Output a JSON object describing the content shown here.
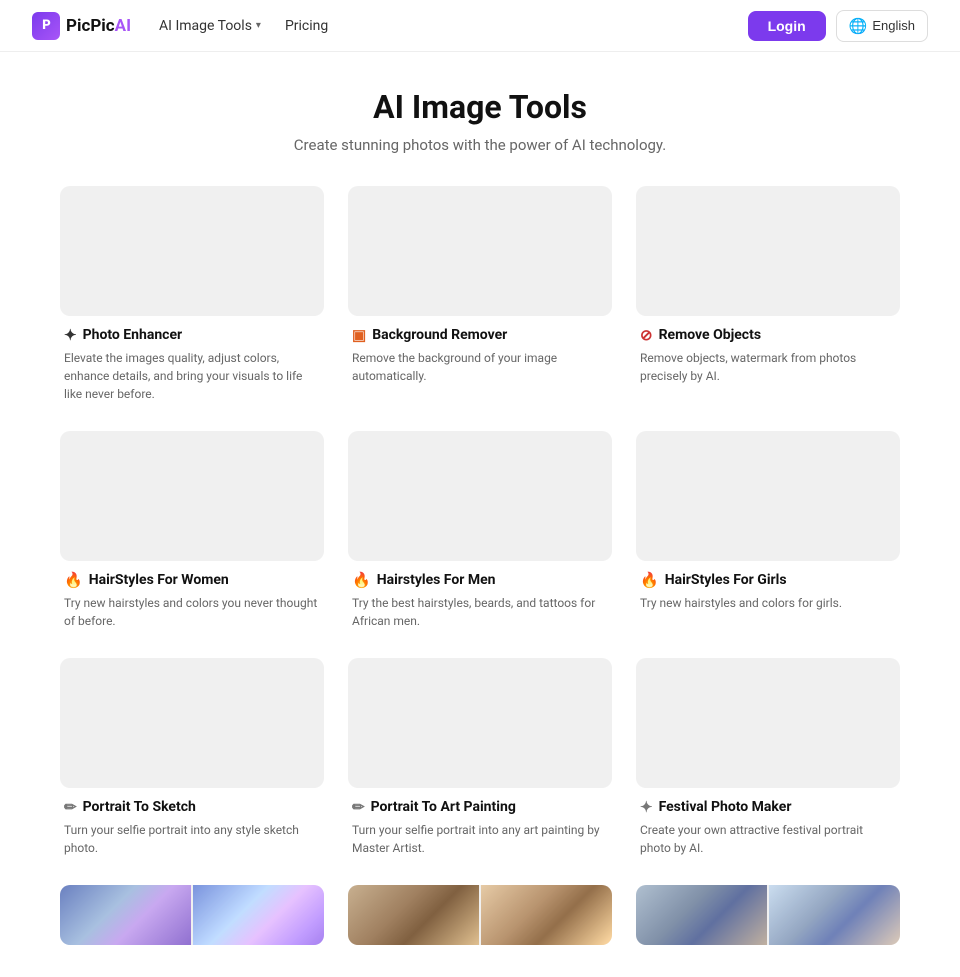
{
  "nav": {
    "logo_letter": "P",
    "logo_name_1": "PicPic",
    "logo_name_2": "AI",
    "menu": [
      {
        "label": "AI Image Tools",
        "has_dropdown": true
      },
      {
        "label": "Pricing",
        "has_dropdown": false
      }
    ],
    "login_label": "Login",
    "lang_label": "English"
  },
  "hero": {
    "title": "AI Image Tools",
    "subtitle": "Create stunning photos with the power of AI technology."
  },
  "tools": [
    {
      "id": "photo-enhancer",
      "icon": "✦",
      "icon_class": "icon-enhance",
      "title": "Photo Enhancer",
      "desc": "Elevate the images quality, adjust colors, enhance details, and bring your visuals to life like never before.",
      "img_class": "img-fox",
      "split": true,
      "img_class2": "img-fox"
    },
    {
      "id": "bg-remover",
      "icon": "▣",
      "icon_class": "icon-bg",
      "title": "Background Remover",
      "desc": "Remove the background of your image automatically.",
      "img_class": "img-girl",
      "split": true,
      "img_class2": "img-girl"
    },
    {
      "id": "remove-objects",
      "icon": "⊘",
      "icon_class": "icon-remove",
      "title": "Remove Objects",
      "desc": "Remove objects, watermark from photos precisely by AI.",
      "img_class": "img-dog",
      "split": true,
      "img_class2": "img-dog"
    },
    {
      "id": "hairstyles-women",
      "icon": "🔥",
      "icon_class": "icon-hair-w",
      "title": "HairStyles For Women",
      "desc": "Try new hairstyles and colors you never thought of before.",
      "img_class": "img-women",
      "split": true,
      "img_class2": "img-women"
    },
    {
      "id": "hairstyles-men",
      "icon": "🔥",
      "icon_class": "icon-hair-m",
      "title": "Hairstyles For Men",
      "desc": "Try the best hairstyles, beards, and tattoos for African men.",
      "img_class": "img-men",
      "split": true,
      "img_class2": "img-men"
    },
    {
      "id": "hairstyles-girls",
      "icon": "🔥",
      "icon_class": "icon-hair-g",
      "title": "HairStyles For Girls",
      "desc": "Try new hairstyles and colors for girls.",
      "img_class": "img-girls",
      "split": true,
      "img_class2": "img-girls"
    },
    {
      "id": "portrait-sketch",
      "icon": "✏",
      "icon_class": "icon-sketch",
      "title": "Portrait To Sketch",
      "desc": "Turn your selfie portrait into any style sketch photo.",
      "img_class": "img-sketch",
      "split": true,
      "img_class2": "img-sketch"
    },
    {
      "id": "portrait-painting",
      "icon": "✏",
      "icon_class": "icon-paint",
      "title": "Portrait To Art Painting",
      "desc": "Turn your selfie portrait into any art painting by Master Artist.",
      "img_class": "img-painting",
      "split": true,
      "img_class2": "img-painting"
    },
    {
      "id": "festival-photo",
      "icon": "✦",
      "icon_class": "icon-festival",
      "title": "Festival Photo Maker",
      "desc": "Create your own attractive festival portrait photo by AI.",
      "img_class": "img-festival",
      "split": true,
      "img_class2": "img-festival"
    }
  ],
  "partial_row": [
    {
      "id": "row4-1",
      "img_class": "img-row4a"
    },
    {
      "id": "row4-2",
      "img_class": "img-row4b"
    },
    {
      "id": "row4-3",
      "img_class": "img-row4c"
    }
  ]
}
